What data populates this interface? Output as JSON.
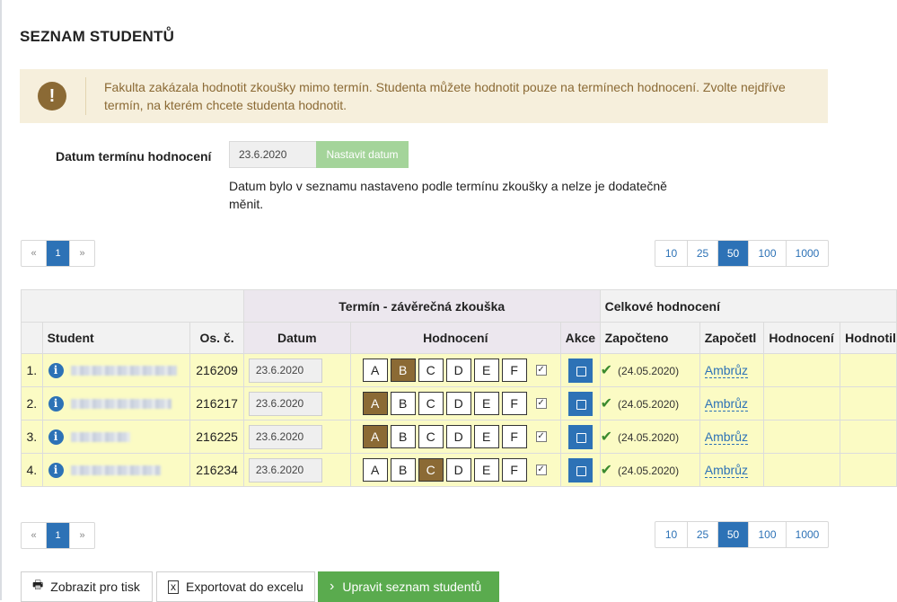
{
  "page_title": "SEZNAM STUDENTŮ",
  "alert": {
    "icon": "exclamation-icon",
    "text": "Fakulta zakázala hodnotit zkoušky mimo termín. Studenta můžete hodnotit pouze na termínech hodnocení. Zvolte nejdříve termín, na kterém chcete studenta hodnotit."
  },
  "date_section": {
    "label": "Datum termínu hodnocení",
    "value": "23.6.2020",
    "button": "Nastavit datum",
    "note": "Datum bylo v seznamu nastaveno podle termínu zkoušky a nelze je dodatečně měnit."
  },
  "pager": {
    "prev": "«",
    "current": "1",
    "next": "»"
  },
  "page_sizes": [
    "10",
    "25",
    "50",
    "100",
    "1000"
  ],
  "page_size_active": "50",
  "table": {
    "group_termin": "Termín - závěrečná zkouška",
    "group_celkove": "Celkové hodnocení",
    "columns": {
      "student": "Student",
      "osc": "Os. č.",
      "datum": "Datum",
      "hodnoceni": "Hodnocení",
      "akce": "Akce",
      "zapocteno": "Započteno",
      "zapocetl": "Započetl",
      "hodnoceni2": "Hodnocení",
      "hodnotil": "Hodnotil"
    },
    "grades": [
      "A",
      "B",
      "C",
      "D",
      "E",
      "F"
    ],
    "rows": [
      {
        "no": "1.",
        "osc": "216209",
        "date": "23.6.2020",
        "selected_grade": "B",
        "zap_date": "(24.05.2020)",
        "teacher": "Ambrůz"
      },
      {
        "no": "2.",
        "osc": "216217",
        "date": "23.6.2020",
        "selected_grade": "A",
        "zap_date": "(24.05.2020)",
        "teacher": "Ambrůz"
      },
      {
        "no": "3.",
        "osc": "216225",
        "date": "23.6.2020",
        "selected_grade": "A",
        "zap_date": "(24.05.2020)",
        "teacher": "Ambrůz"
      },
      {
        "no": "4.",
        "osc": "216234",
        "date": "23.6.2020",
        "selected_grade": "C",
        "zap_date": "(24.05.2020)",
        "teacher": "Ambrůz"
      }
    ]
  },
  "buttons": {
    "print": "Zobrazit pro tisk",
    "export": "Exportovat do excelu",
    "edit": "Upravit seznam studentů"
  },
  "colors": {
    "accent": "#2d72b6",
    "grade_selected": "#8b6a35",
    "row_bg": "#fbfbc4",
    "alert_bg": "#f6efdc",
    "success": "#5aab4e"
  }
}
